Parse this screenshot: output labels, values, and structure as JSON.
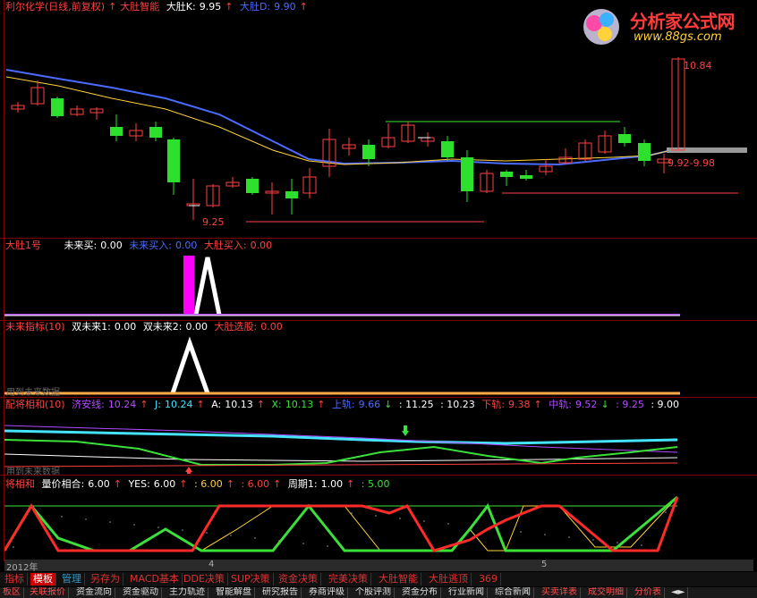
{
  "colors": {
    "red": "#ff4040",
    "yellow": "#ffd23a",
    "white": "#ffffff",
    "blue": "#4a6bff",
    "cyan": "#44e4ff",
    "green": "#3be03b",
    "magenta": "#ff00ff",
    "purple": "#b04cff",
    "orange": "#ffaa44"
  },
  "main": {
    "stock": "利尔化学(日线,前复权)",
    "arrow": "↑",
    "indicator": "大肚智能",
    "k_label": "大肚K:",
    "k_value": "9.95",
    "k_arrow": "↑",
    "d_label": "大肚D:",
    "d_value": "9.90",
    "d_arrow": "↑",
    "high_label": "10.84",
    "low_label": "9.25",
    "range_label": "9.92-9.98"
  },
  "watermark": {
    "title": "分析家公式网",
    "url": "www.88gs.com"
  },
  "p1": {
    "name": "大肚1号",
    "a_label": "未来买:",
    "a_value": "0.00",
    "b_label": "未来买入:",
    "b_value": "0.00",
    "c_label": "大肚买入:",
    "c_value": "0.00"
  },
  "p2": {
    "name": "未来指标(10)",
    "a_label": "双未来1:",
    "a_value": "0.00",
    "b_label": "双未来2:",
    "b_value": "0.00",
    "c_label": "大肚选股:",
    "c_value": "0.00",
    "note": "用到未来数据"
  },
  "p3": {
    "name": "配将相和(10)",
    "a_label": "济安线:",
    "a_value": "10.24",
    "a_arrow": "↑",
    "b_label": "J:",
    "b_value": "10.24",
    "b_arrow": "↑",
    "c_label": "A:",
    "c_value": "10.13",
    "c_arrow": "↑",
    "d_label": "X:",
    "d_value": "10.13",
    "d_arrow": "↑",
    "e_label": "上轨:",
    "e_value": "9.66",
    "e_arrow": "↓",
    "f_value": ": 11.25",
    "g_value": ": 10.23",
    "h_label": "下轨:",
    "h_value": "9.38",
    "h_arrow": "↑",
    "i_label": "中轨:",
    "i_value": "9.52",
    "i_arrow": "↓",
    "j_value": ": 9.25",
    "k_value": ": 9.00",
    "note": "用到未来数据"
  },
  "p4": {
    "name": "将相和",
    "a_label": "量价相合:",
    "a_value": "6.00",
    "a_arrow": "↑",
    "b_label": "YES:",
    "b_value": "6.00",
    "b_arrow": "↑",
    "c_value": ": 6.00",
    "c_arrow": "↑",
    "d_value": ": 6.00",
    "d_arrow": "↑",
    "e_label": "周期1:",
    "e_value": "1.00",
    "e_arrow": "↑",
    "f_value": ": 5.00"
  },
  "axis": {
    "year": "2012年",
    "m4": "4",
    "m5": "5"
  },
  "tabs": [
    "指标",
    "模板",
    "管理",
    "另存为",
    "MACD基本",
    "DDE决策",
    "SUP决策",
    "资金决策",
    "完美决策",
    "大肚智能",
    "大肚逃顶",
    "369"
  ],
  "menu": [
    "板区",
    "关联报价",
    "资金流向",
    "资金驱动",
    "主力轨迹",
    "智能解盘",
    "研究报告",
    "券商评级",
    "个股评测",
    "资金分布",
    "行业新闻",
    "综合新闻",
    "买卖详表",
    "成交明细",
    "分价表",
    "◄►"
  ]
}
